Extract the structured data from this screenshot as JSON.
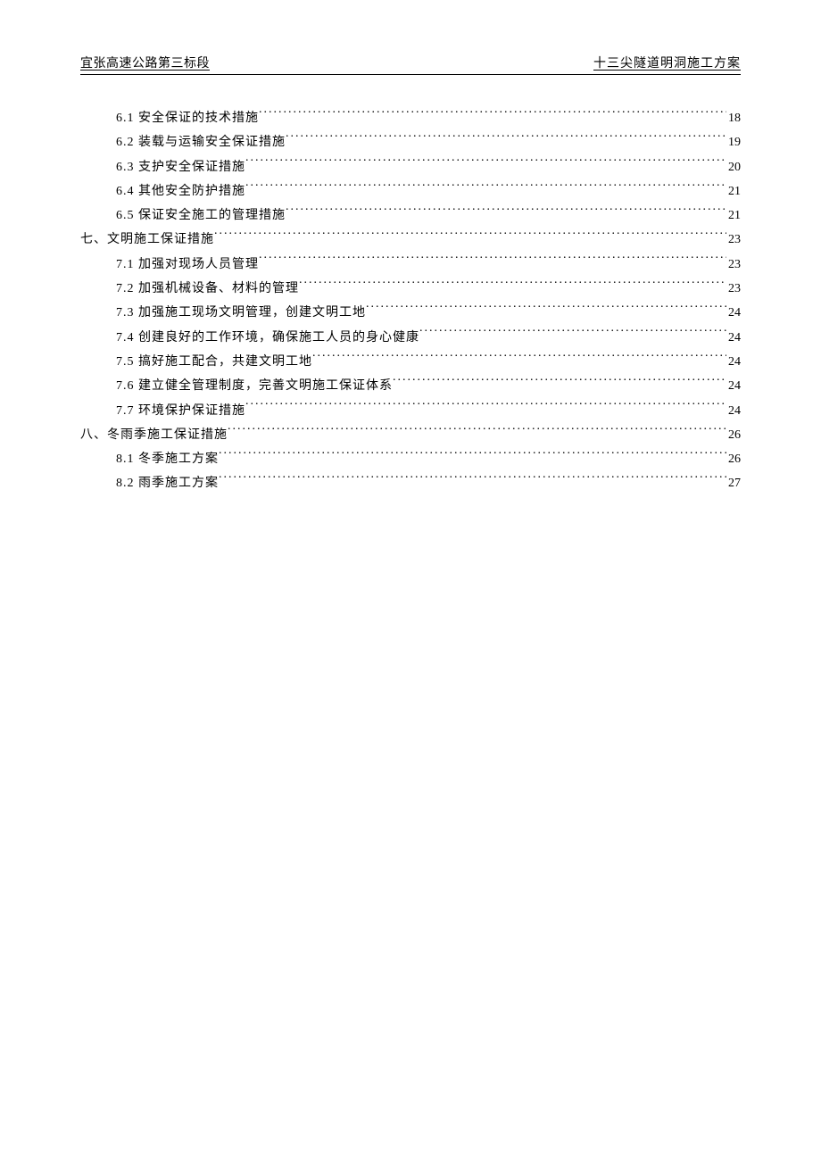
{
  "header": {
    "left": "宜张高速公路第三标段",
    "right": "十三尖隧道明洞施工方案"
  },
  "toc": [
    {
      "type": "sub",
      "label": "6.1 安全保证的技术措施",
      "page": "18"
    },
    {
      "type": "sub",
      "label": "6.2 装载与运输安全保证措施",
      "page": "19"
    },
    {
      "type": "sub",
      "label": "6.3 支护安全保证措施",
      "page": "20"
    },
    {
      "type": "sub",
      "label": "6.4 其他安全防护措施",
      "page": "21"
    },
    {
      "type": "sub",
      "label": "6.5 保证安全施工的管理措施",
      "page": "21"
    },
    {
      "type": "section",
      "label": "七、文明施工保证措施",
      "page": "23"
    },
    {
      "type": "sub",
      "label": "7.1 加强对现场人员管理",
      "page": "23"
    },
    {
      "type": "sub",
      "label": "7.2 加强机械设备、材料的管理",
      "page": "23"
    },
    {
      "type": "sub",
      "label": "7.3 加强施工现场文明管理，创建文明工地",
      "page": "24"
    },
    {
      "type": "sub",
      "label": "7.4 创建良好的工作环境，确保施工人员的身心健康",
      "page": "24"
    },
    {
      "type": "sub",
      "label": "7.5 搞好施工配合，共建文明工地",
      "page": "24"
    },
    {
      "type": "sub",
      "label": "7.6 建立健全管理制度，完善文明施工保证体系",
      "page": "24"
    },
    {
      "type": "sub",
      "label": "7.7 环境保护保证措施",
      "page": "24"
    },
    {
      "type": "section",
      "label": "八、冬雨季施工保证措施",
      "page": "26"
    },
    {
      "type": "sub",
      "label": "8.1 冬季施工方案",
      "page": "26"
    },
    {
      "type": "sub",
      "label": "8.2 雨季施工方案",
      "page": "27"
    }
  ]
}
